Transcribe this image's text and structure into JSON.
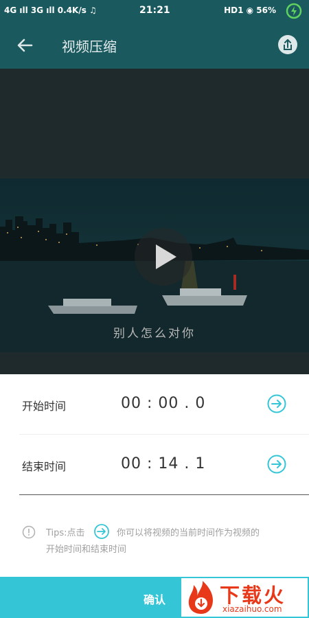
{
  "status_bar": {
    "left": "4G ıll 3G ıll 0.4K/s ♫",
    "time": "21:21",
    "right": "HD1 ◉ 56%"
  },
  "app_bar": {
    "title": "视频压缩"
  },
  "video": {
    "subtitle": "别人怎么对你"
  },
  "rows": [
    {
      "label": "开始时间",
      "value": "00 : 00 . 0"
    },
    {
      "label": "结束时间",
      "value": "00 : 14 . 1"
    }
  ],
  "tips": {
    "prefix": "Tips:点击",
    "line1": "你可以将视频的当前时间作为视频的",
    "line2": "开始时间和结束时间"
  },
  "confirm": {
    "label": "确认"
  },
  "watermark": {
    "text": "下载火",
    "domain": "xiazaihuo.com"
  },
  "colors": {
    "primary": "#1a5a5e",
    "accent": "#34c6d6",
    "watermark": "#e8381a"
  }
}
